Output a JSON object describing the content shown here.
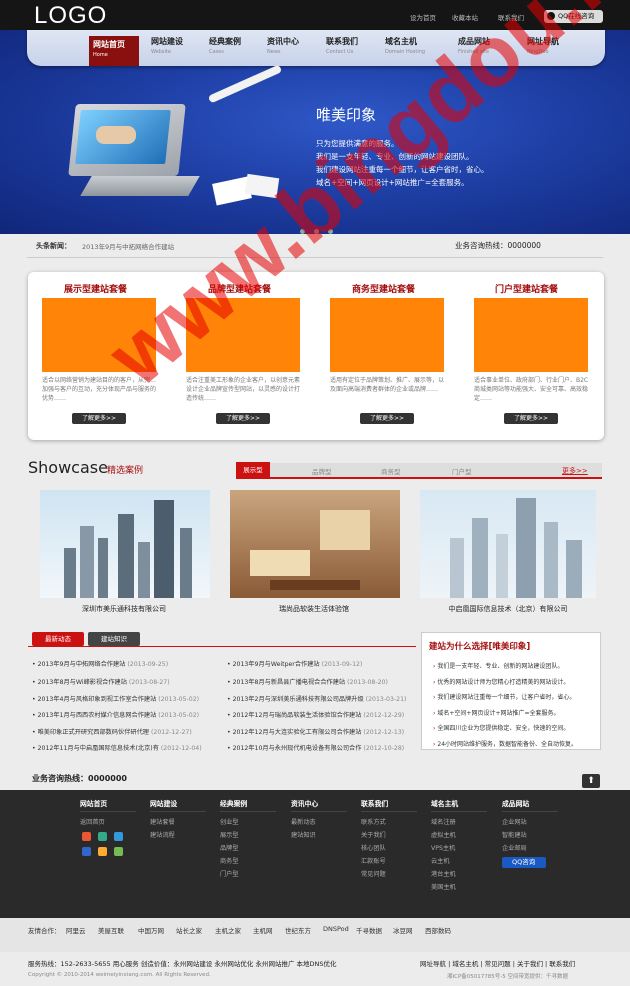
{
  "header": {
    "logo": "LOGO",
    "links": [
      "设为首页",
      "收藏本站",
      "联系我们"
    ],
    "qq": "QQ在线咨询"
  },
  "nav": [
    {
      "label": "网站首页",
      "en": "Home"
    },
    {
      "label": "网站建设",
      "en": "Website"
    },
    {
      "label": "经典案例",
      "en": "Cases"
    },
    {
      "label": "资讯中心",
      "en": "News"
    },
    {
      "label": "联系我们",
      "en": "Contact Us"
    },
    {
      "label": "域名主机",
      "en": "Domain Hosting"
    },
    {
      "label": "成品网站",
      "en": "Finished site"
    },
    {
      "label": "网址导航",
      "en": "NingDuo"
    }
  ],
  "banner": {
    "title": "唯美印象",
    "lines": [
      "只为您提供满意的服务。",
      "我们是一支年轻、专业、创新的网站建设团队。",
      "我们建设网站注重每一个细节，让客户省时，省心。",
      "域名+空间+网页设计+网站推广=全套服务。"
    ]
  },
  "news": {
    "label": "头条新闻：",
    "text": "2013年9月与中拓网络合作建站",
    "hotline": "业务咨询热线：0000000"
  },
  "packages": [
    {
      "title": "展示型建站套餐",
      "desc": "适合以网络营销为建站目的的客户，从完…加强与客户的互动，充分体现产品与服务的优势……",
      "btn": "了解更多>>"
    },
    {
      "title": "品牌型建站套餐",
      "desc": "适合注重美工形象的企业客户，以创意元素设计企业品牌宣传型网站，以灵感的设计打造传统……",
      "btn": "了解更多>>"
    },
    {
      "title": "商务型建站套餐",
      "desc": "适用有定位于品牌策划、推广、展示等，以及面向高端消费者群体的企业或品牌……",
      "btn": "了解更多>>"
    },
    {
      "title": "门户型建站套餐",
      "desc": "适合事业单位、政府部门、行业门户、B2C商城类网站等功能强大、安全可靠、高效稳定……",
      "btn": "了解更多>>"
    }
  ],
  "showcase": {
    "title": "Showcase",
    "title_cn": "精选案例",
    "tabs": [
      "展示型",
      "品牌型",
      "商务型",
      "门户型"
    ],
    "more": "更多>>",
    "items": [
      "深圳市美乐通科技有限公司",
      "瑞尚品软装生活体验馆",
      "中启凰国际信息技术（北京）有限公司"
    ]
  },
  "news_tabs": [
    "最新动态",
    "建站知识"
  ],
  "news_left": [
    {
      "t": "2013年9月与中拓网络合作建站",
      "d": "(2013-09-25)"
    },
    {
      "t": "2013年8月与Wi峰影视合作建站",
      "d": "(2013-08-27)"
    },
    {
      "t": "2013年4月与风格印象到视工作室合作建站",
      "d": "(2013-05-02)"
    },
    {
      "t": "2013年1月与西西农村媒介信息网合作建站",
      "d": "(2013-05-02)"
    },
    {
      "t": "唯美印象正式开研究西部数码伙伴研代理",
      "d": "(2012-12-27)"
    },
    {
      "t": "2012年11月与中启凰国际信息技术(北京)有",
      "d": "(2012-12-04)"
    }
  ],
  "news_right": [
    {
      "t": "2013年9月与Weitper合作建站",
      "d": "(2013-09-12)"
    },
    {
      "t": "2013年8月与新昌县广播电视合合作建站",
      "d": "(2013-08-20)"
    },
    {
      "t": "2013年2月与深圳美乐通科技有限公司品牌升级",
      "d": "(2013-03-21)"
    },
    {
      "t": "2012年12月与瑞尚品软装生活体验馆合作建站",
      "d": "(2012-12-29)"
    },
    {
      "t": "2012年12月与大连实验化工有限公司合作建站",
      "d": "(2012-12-13)"
    },
    {
      "t": "2012年10月与永州现代机电设备有限公司合作",
      "d": "(2012-10-28)"
    }
  ],
  "why": {
    "title": "建站为什么选择[唯美印象]",
    "items": [
      "我们是一支年轻、专业、创新的网站建设团队。",
      "优秀的网站设计师为您精心打造精美的网站设计。",
      "我们建设网站注重每一个细节，让客户省时，省心。",
      "域名+空间+网页设计+网站推广=全套服务。",
      "全国四川企业为您提供稳定、安全，快速的空间。",
      "24小时网站维护服务，数据智能备份、全自动恢复。"
    ]
  },
  "hotline2": "业务咨询热线：0000000",
  "footer": {
    "cols": [
      {
        "h": "网站首页",
        "items": [
          "返回首页"
        ]
      },
      {
        "h": "网站建设",
        "items": [
          "建站套餐",
          "建站流程"
        ]
      },
      {
        "h": "经典案例",
        "items": [
          "创业型",
          "展示型",
          "品牌型",
          "商务型",
          "门户型"
        ]
      },
      {
        "h": "资讯中心",
        "items": [
          "最新动态",
          "建站知识"
        ]
      },
      {
        "h": "联系我们",
        "items": [
          "联系方式",
          "关于我们",
          "核心团队",
          "汇款账号",
          "常见问题"
        ]
      },
      {
        "h": "域名主机",
        "items": [
          "域名注册",
          "虚拟主机",
          "VPS主机",
          "云主机",
          "港台主机",
          "美国主机"
        ]
      },
      {
        "h": "成品网站",
        "items": [
          "企业网站",
          "智能建站",
          "企业邮局"
        ]
      }
    ],
    "qq": "QQ咨询"
  },
  "friend_label": "友情合作：",
  "friends": [
    "阿里云",
    "美屋互联",
    "中国万网",
    "站长之家",
    "主机之家",
    "主机网",
    "世纪东方",
    "DNSPod",
    "千寻数据",
    "冰豆网",
    "西部数码"
  ],
  "bottom": {
    "left1": "服务热线：152-2633-5655  用心服务 创造价值：永州网站建设  永州网站优化  永州网站推广  本地DNS优化",
    "left2": "Copyright © 2010-2014 weimeiyinxiang.com. All Rights Reserved.",
    "right1": "网址导航 | 域名主机 | 常见问题 | 关于我们 | 联系我们",
    "right2": "湘ICP备05017785号-5  空间带宽提供：千寻数据"
  },
  "watermark": "www.bingdou.net"
}
